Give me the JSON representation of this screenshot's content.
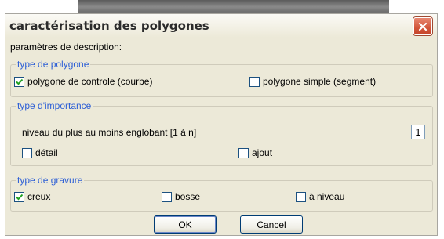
{
  "window": {
    "title": "caractérisation des polygones"
  },
  "description_label": "paramètres de description:",
  "polygon_type": {
    "title": "type de polygone",
    "options": [
      {
        "label": "polygone de controle (courbe)",
        "checked": true
      },
      {
        "label": "polygone simple (segment)",
        "checked": false
      }
    ]
  },
  "importance": {
    "title": "type d'importance",
    "level_label": "niveau du plus au moins englobant [1 à n]",
    "level_value": "1",
    "detail_label": "détail",
    "detail_checked": false,
    "ajout_label": "ajout",
    "ajout_checked": false
  },
  "engraving": {
    "title": "type de gravure",
    "options": [
      {
        "label": "creux",
        "checked": true
      },
      {
        "label": "bosse",
        "checked": false
      },
      {
        "label": "à niveau",
        "checked": false
      }
    ]
  },
  "buttons": {
    "ok_label": "OK",
    "cancel_label": "Cancel"
  },
  "colors": {
    "group_title": "#2d5fd6",
    "check_mark": "#21a121",
    "close_button": "#d2553a",
    "dialog_background": "#ece9d8"
  }
}
